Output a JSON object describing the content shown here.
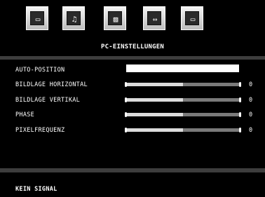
{
  "menu": {
    "icons": [
      {
        "name": "picture-icon",
        "glyph": "▭"
      },
      {
        "name": "music-note-icon",
        "glyph": "♫"
      },
      {
        "name": "screen-pattern-icon",
        "glyph": "▨"
      },
      {
        "name": "connector-icon",
        "glyph": "⇔"
      },
      {
        "name": "pc-monitor-icon",
        "glyph": "▭"
      }
    ],
    "title": "PC-EINSTELLUNGEN"
  },
  "settings": {
    "auto_position": {
      "label": "AUTO-POSITION"
    },
    "bildlage_horizontal": {
      "label": "BILDLAGE HORIZONTAL",
      "value": "0",
      "level": 0.5
    },
    "bildlage_vertikal": {
      "label": "BILDLAGE VERTIKAL",
      "value": "0",
      "level": 0.5
    },
    "phase": {
      "label": "PHASE",
      "value": "0",
      "level": 0.5
    },
    "pixelfrequenz": {
      "label": "PIXELFREQUENZ",
      "value": "0",
      "level": 0.5
    }
  },
  "status": {
    "text": "KEIN SIGNAL"
  },
  "colors": {
    "background": "#000000",
    "band": "#3d3d3d",
    "text": "#ffffff"
  }
}
